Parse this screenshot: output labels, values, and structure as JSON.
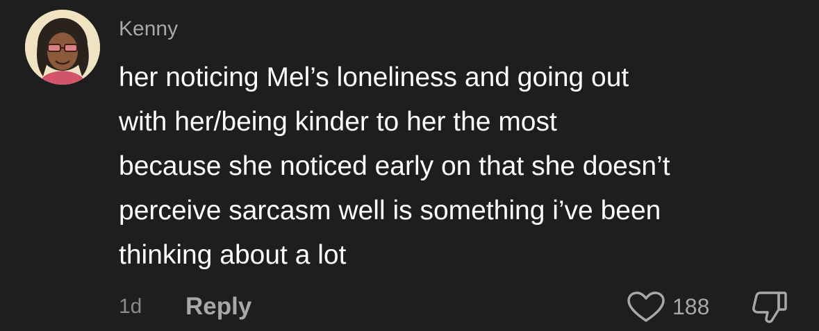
{
  "comment": {
    "username": "Kenny",
    "lines": [
      "her noticing Mel’s loneliness and going out",
      "with her/being kinder to her the most",
      "because she noticed early on that she doesn’t",
      "perceive sarcasm well is something i’ve been",
      "thinking about a lot"
    ],
    "age": "1d",
    "reply_label": "Reply",
    "like_count": "188",
    "icons": {
      "like": "heart-icon",
      "dislike": "thumbs-down-icon"
    }
  },
  "colors": {
    "background": "#1e1e1e",
    "text_primary": "#ffffff",
    "text_secondary": "#a8a8a8",
    "text_muted": "#8a8a8a"
  }
}
